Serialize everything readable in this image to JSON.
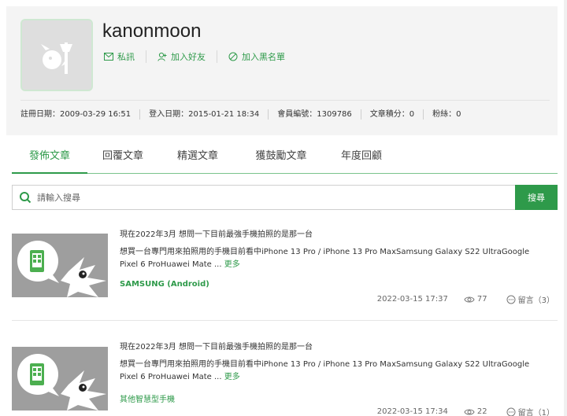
{
  "profile": {
    "username": "kanonmoon",
    "actions": [
      {
        "label": "私訊",
        "icon": "mail-icon"
      },
      {
        "label": "加入好友",
        "icon": "add-friend-icon"
      },
      {
        "label": "加入黑名單",
        "icon": "block-icon"
      }
    ],
    "stats": [
      "註冊日期：2009-03-29 16:51",
      "登入日期：2015-01-21 18:34",
      "會員編號：1309786",
      "文章積分：0",
      "粉絲：0"
    ]
  },
  "tabs": [
    "發佈文章",
    "回覆文章",
    "精選文章",
    "獲鼓勵文章",
    "年度回顧"
  ],
  "search": {
    "placeholder": "請輸入搜尋",
    "button_label": "搜尋"
  },
  "posts": [
    {
      "title": "現在2022年3月 想問一下目前最強手機拍照的是那一台",
      "body": "想買一台專門用來拍照用的手機目前看中iPhone 13 Pro / iPhone 13 Pro MaxSamsung Galaxy S22 UltraGoogle Pixel 6 ProHuawei Mate ...",
      "more": "更多",
      "tag": "SAMSUNG (Android)",
      "date": "2022-03-15 17:37",
      "views": "77",
      "comments": "留言（3）"
    },
    {
      "title": "現在2022年3月 想問一下目前最強手機拍照的是那一台",
      "body": "想買一台專門用來拍照用的手機目前看中iPhone 13 Pro / iPhone 13 Pro MaxSamsung Galaxy S22 UltraGoogle Pixel 6 ProHuawei Mate ...",
      "more": "更多",
      "tag": "其他智慧型手機",
      "date": "2022-03-15 17:34",
      "views": "22",
      "comments": "留言（1）"
    }
  ],
  "colors": {
    "accent": "#2e9a4a",
    "card_bg": "#f4f4f4",
    "thumb_bg": "#9e9e9e"
  }
}
